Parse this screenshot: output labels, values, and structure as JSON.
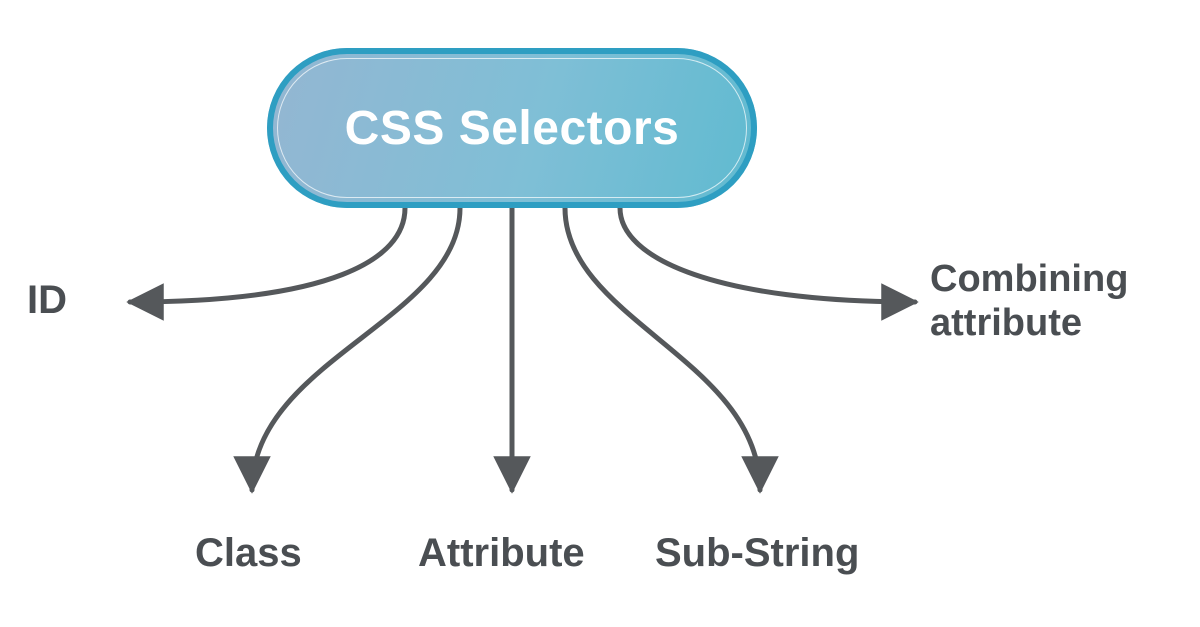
{
  "diagram": {
    "root": {
      "label": "CSS Selectors"
    },
    "leaves": {
      "id": {
        "label": "ID"
      },
      "class": {
        "label": "Class"
      },
      "attribute": {
        "label": "Attribute"
      },
      "substring": {
        "label": "Sub-String"
      },
      "combining_line1": {
        "label": "Combining"
      },
      "combining_line2": {
        "label": "attribute"
      }
    },
    "colors": {
      "arrow": "#55585b",
      "text": "#4a4e52",
      "pill_border": "#2e9ec2",
      "pill_fill_start": "#94b6d2",
      "pill_fill_end": "#5fbad0"
    }
  }
}
